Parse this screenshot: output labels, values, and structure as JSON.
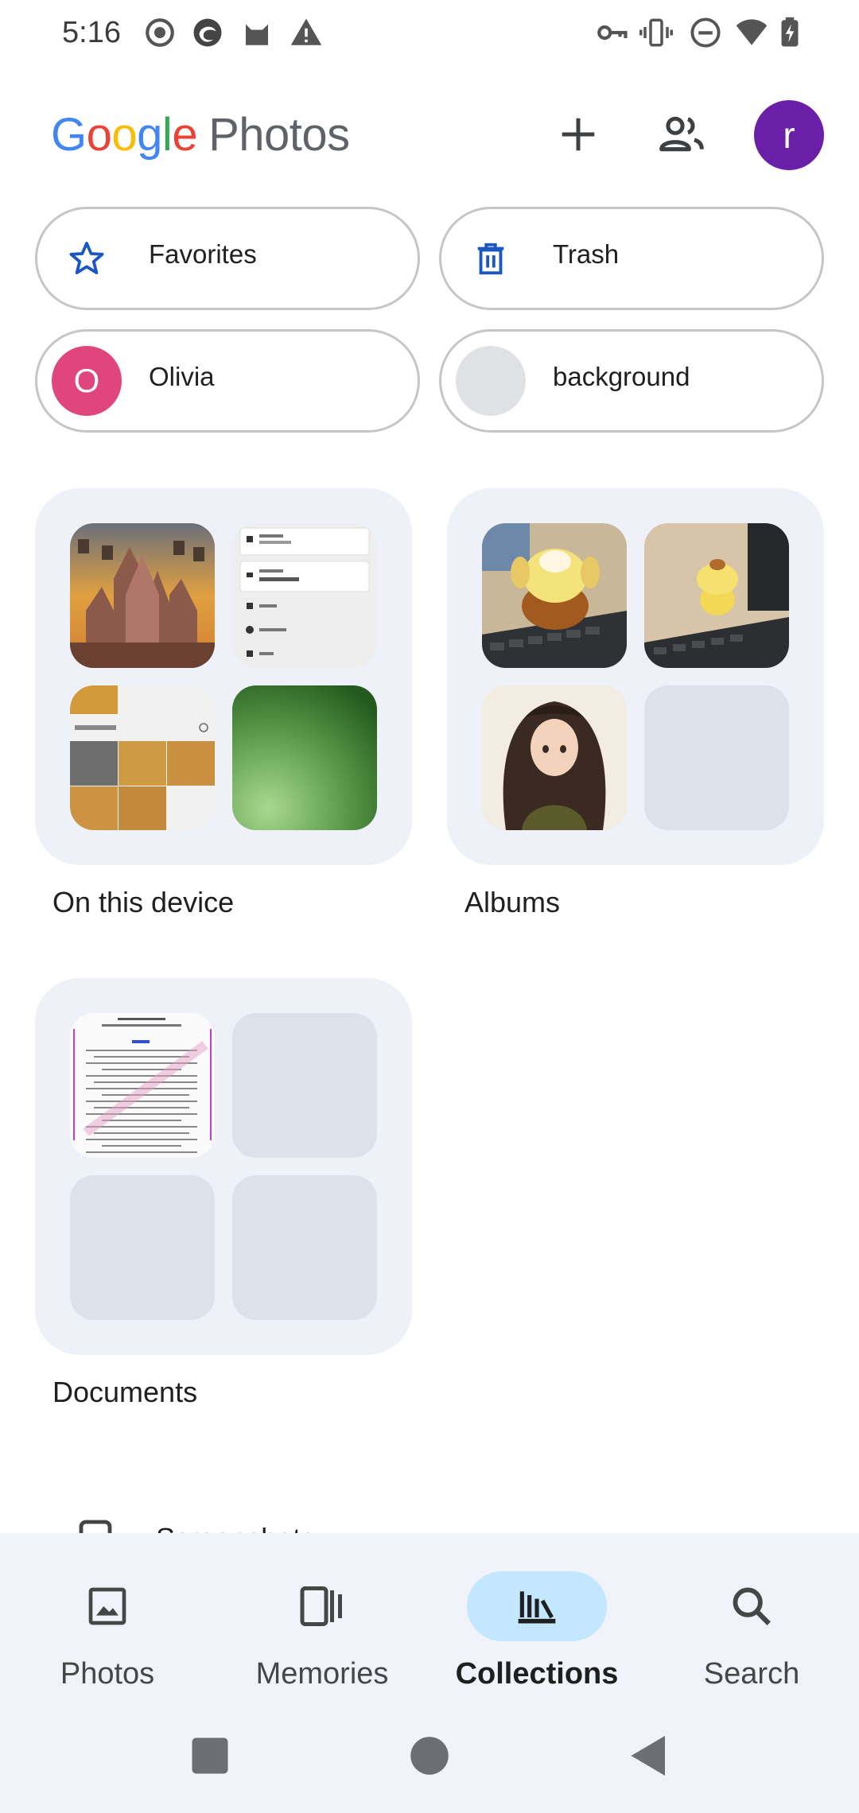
{
  "status_bar": {
    "time": "5:16",
    "left_icons": [
      "record-icon",
      "edge-icon",
      "cat-icon",
      "warning-icon"
    ],
    "right_icons": [
      "vpn-key-icon",
      "vibrate-icon",
      "dnd-icon",
      "wifi-icon",
      "battery-charging-icon"
    ]
  },
  "header": {
    "logo_google": [
      "G",
      "o",
      "o",
      "g",
      "l",
      "e"
    ],
    "logo_photos": "Photos",
    "add_icon": "plus-icon",
    "sharing_icon": "people-icon",
    "avatar_letter": "r",
    "avatar_color": "#6a1fa8"
  },
  "chips": [
    {
      "label": "Favorites",
      "icon": "star-icon"
    },
    {
      "label": "Trash",
      "icon": "trash-icon"
    },
    {
      "label": "Olivia",
      "icon_letter": "O",
      "icon_color": "#e0457b"
    },
    {
      "label": "background",
      "icon_color": "#dfe1e5"
    }
  ],
  "collections": [
    {
      "label": "On this device"
    },
    {
      "label": "Albums"
    },
    {
      "label": "Documents"
    }
  ],
  "partial_item": {
    "label": "Screenshots"
  },
  "nav": [
    {
      "label": "Photos",
      "icon": "photo-icon",
      "active": false
    },
    {
      "label": "Memories",
      "icon": "memories-icon",
      "active": false
    },
    {
      "label": "Collections",
      "icon": "collections-icon",
      "active": true
    },
    {
      "label": "Search",
      "icon": "search-icon",
      "active": false
    }
  ],
  "system_nav": [
    "recents-square-icon",
    "home-circle-icon",
    "back-triangle-icon"
  ],
  "colors": {
    "accent": "#c2e7ff",
    "card_bg": "#eef2f8",
    "nav_bg": "#f0f3f9",
    "icon_blue": "#1a56c4"
  }
}
